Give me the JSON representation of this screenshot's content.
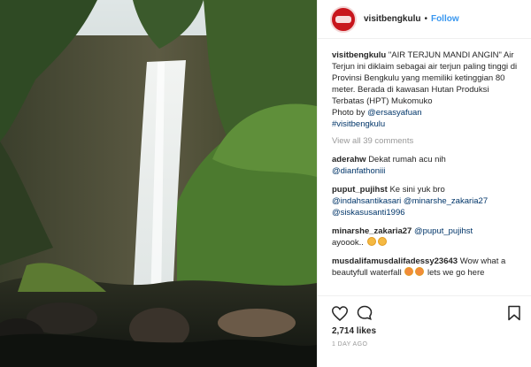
{
  "header": {
    "username": "visitbengkulu",
    "dot": "•",
    "follow_label": "Follow"
  },
  "caption": {
    "username": "visitbengkulu",
    "text": "\"AIR TERJUN MANDI ANGIN\" Air Terjun ini diklaim sebagai air terjun paling tinggi di Provinsi Bengkulu yang memiliki ketinggian 80 meter. Berada di kawasan Hutan Produksi Terbatas (HPT) Mukomuko",
    "photo_by": "Photo by",
    "photo_credit": "@ersasyafuan",
    "hashtag": "#visitbengkulu"
  },
  "view_all": "View all 39 comments",
  "comments": [
    {
      "user": "aderahw",
      "text": "Dekat rumah acu nih",
      "mentions": "@dianfathoniii"
    },
    {
      "user": "puput_pujihst",
      "text": "Ke sini yuk bro",
      "mentions": "@indahsantikasari @minarshe_zakaria27 @siskasusanti1996"
    },
    {
      "user": "minarshe_zakaria27",
      "text": "ayoook..",
      "mentions": "@puput_pujihst"
    },
    {
      "user": "musdalifamusdalifadessy23643",
      "text": "Wow what a beautyfull waterfall",
      "text2": "lets we go here"
    }
  ],
  "likes": "2,714 likes",
  "time": "1 DAY AGO",
  "icons": [
    "heart-icon",
    "comment-icon",
    "bookmark-icon"
  ],
  "colors": {
    "follow": "#3897f0",
    "avatar": "#c8161d"
  }
}
